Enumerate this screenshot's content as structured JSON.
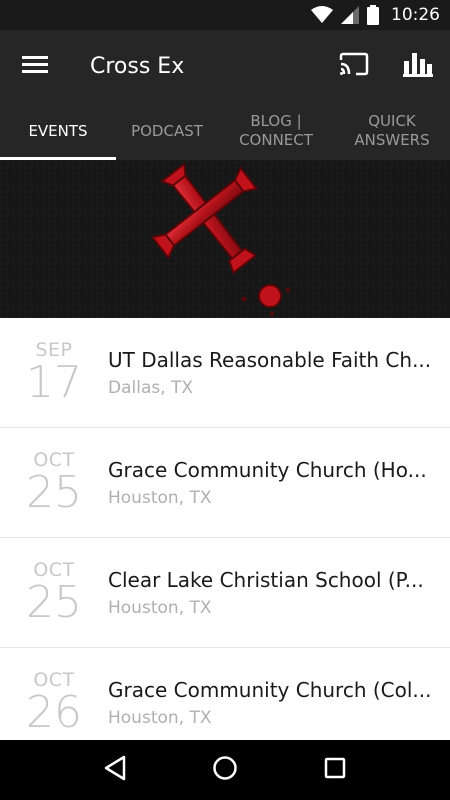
{
  "status": {
    "time": "10:26",
    "icons": [
      "wifi-icon",
      "signal-icon",
      "battery-icon"
    ]
  },
  "app_bar": {
    "title": "Cross Ex",
    "icons": [
      "menu-icon",
      "cast-icon",
      "bar-chart-icon"
    ]
  },
  "tabs": [
    {
      "label": "EVENTS",
      "active": true
    },
    {
      "label": "PODCAST",
      "active": false
    },
    {
      "label": "BLOG | CONNECT",
      "active": false
    },
    {
      "label": "QUICK ANSWERS",
      "active": false
    }
  ],
  "banner": {
    "image": "red-cross-logo",
    "colors": {
      "cross": "#c0121b",
      "background": "#161616"
    }
  },
  "events": [
    {
      "month": "SEP",
      "day": "17",
      "name": "UT Dallas Reasonable Faith Ch...",
      "location": "Dallas, TX"
    },
    {
      "month": "OCT",
      "day": "25",
      "name": "Grace Community Church (Ho...",
      "location": "Houston, TX"
    },
    {
      "month": "OCT",
      "day": "25",
      "name": "Clear Lake Christian School (P...",
      "location": "Houston, TX"
    },
    {
      "month": "OCT",
      "day": "26",
      "name": "Grace Community Church (Col...",
      "location": "Houston, TX"
    }
  ],
  "nav": {
    "icons": [
      "back-icon",
      "home-icon",
      "recents-icon"
    ]
  },
  "colors": {
    "app_bar": "#262626",
    "status_bar": "#1a1a1a",
    "tab_inactive": "#9a9a9a",
    "tab_active": "#ffffff",
    "date_text": "#c8c8c8",
    "location_text": "#b0b0b0"
  }
}
